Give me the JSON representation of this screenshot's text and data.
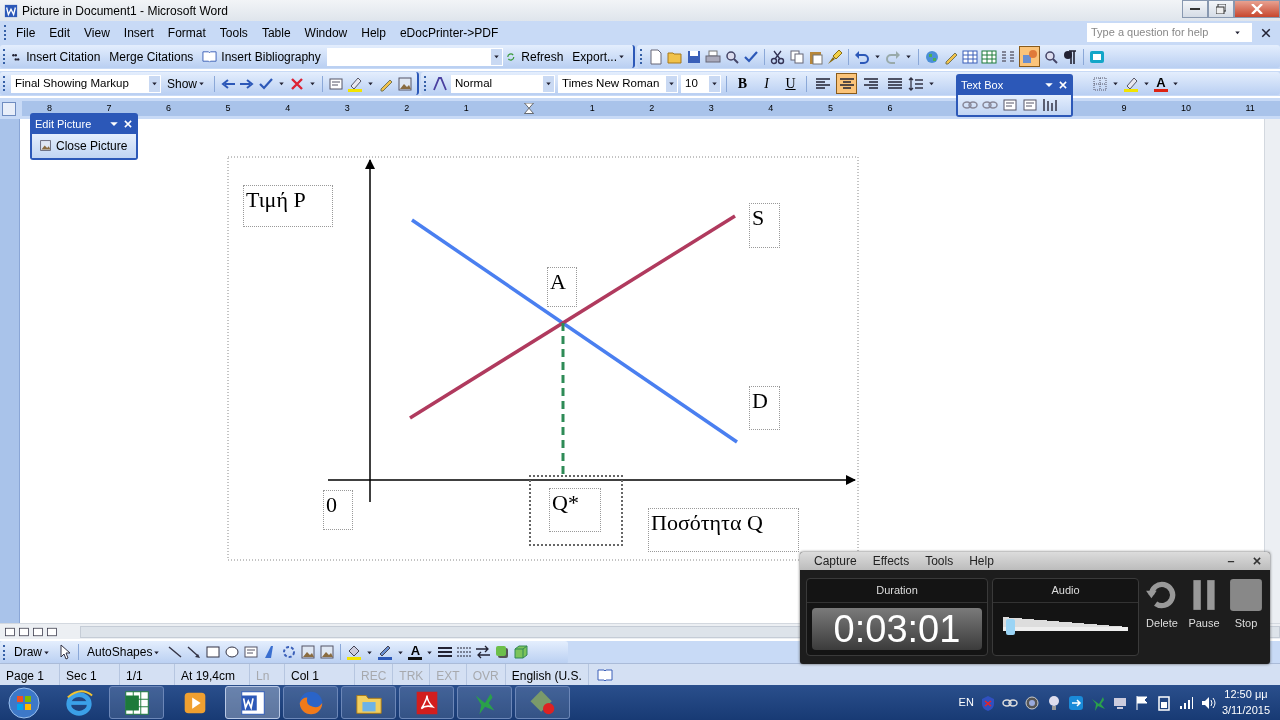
{
  "window": {
    "title": "Picture in Document1 - Microsoft Word"
  },
  "menu": [
    "File",
    "Edit",
    "View",
    "Insert",
    "Format",
    "Tools",
    "Table",
    "Window",
    "Help",
    "eDocPrinter->PDF"
  ],
  "help_box": {
    "placeholder": "Type a question for help"
  },
  "citation_toolbar": {
    "items": [
      "Insert Citation",
      "Merge Citations",
      "Insert Bibliography"
    ],
    "refresh": "Refresh",
    "export": "Export..."
  },
  "standard_toolbar": {
    "drawing_button_pressed": true
  },
  "reviewing_toolbar": {
    "display": "Final Showing Markup",
    "show": "Show"
  },
  "formatting_toolbar": {
    "style": "Normal",
    "font": "Times New Roman",
    "size": "10",
    "format_buttons": [
      {
        "label": "B",
        "selected": false
      },
      {
        "label": "I",
        "selected": false
      },
      {
        "label": "U",
        "selected": false
      }
    ],
    "alignments": [
      {
        "kind": "left",
        "selected": false
      },
      {
        "kind": "center",
        "selected": true
      },
      {
        "kind": "right",
        "selected": false
      },
      {
        "kind": "justify",
        "selected": false
      }
    ],
    "font_color_glyph": "A"
  },
  "ruler": {
    "left_numbers": [
      "8",
      "7",
      "6",
      "5",
      "4",
      "3",
      "2",
      "1"
    ],
    "right_numbers": [
      "1",
      "2",
      "3",
      "4",
      "5",
      "6"
    ],
    "numbers_past_toolbar": [
      "9",
      "10",
      "11"
    ]
  },
  "edit_picture_toolbar": {
    "title": "Edit Picture",
    "close_button": "Close Picture"
  },
  "text_box_toolbar": {
    "title": "Text Box"
  },
  "diagram": {
    "labels": [
      {
        "kind": "price_axis",
        "text": "Τιμή P",
        "selected": false
      },
      {
        "kind": "supply",
        "text": "S",
        "selected": false
      },
      {
        "kind": "equilibrium",
        "text": "A",
        "selected": false
      },
      {
        "kind": "demand",
        "text": "D",
        "selected": false
      },
      {
        "kind": "origin",
        "text": "0",
        "selected": false
      },
      {
        "kind": "equilibrium_quantity",
        "text": "Q*",
        "selected": true
      },
      {
        "kind": "quantity_axis",
        "text": "Ποσότητα Q",
        "selected": false
      }
    ]
  },
  "drawing_toolbar": {
    "draw": "Draw",
    "autoshapes": "AutoShapes",
    "font_color_glyph": "A"
  },
  "status_bar": [
    {
      "text": "Page 1",
      "disabled": false
    },
    {
      "text": "Sec 1",
      "disabled": false
    },
    {
      "text": "1/1",
      "disabled": false
    },
    {
      "text": "At 19,4cm",
      "disabled": false
    },
    {
      "text": "Ln",
      "disabled": true
    },
    {
      "text": "Col 1",
      "disabled": false
    },
    {
      "text": "REC",
      "disabled": true
    },
    {
      "text": "TRK",
      "disabled": true
    },
    {
      "text": "EXT",
      "disabled": true
    },
    {
      "text": "OVR",
      "disabled": true
    },
    {
      "text": "English (U.S.",
      "disabled": false
    }
  ],
  "recorder": {
    "menu": [
      "Capture",
      "Effects",
      "Tools",
      "Help"
    ],
    "duration_label": "Duration",
    "duration": "0:03:01",
    "audio_label": "Audio",
    "audio": {
      "level": 0.03
    },
    "buttons": [
      {
        "kind": "delete",
        "label": "Delete"
      },
      {
        "kind": "pause",
        "label": "Pause"
      },
      {
        "kind": "stop",
        "label": "Stop"
      }
    ]
  },
  "taskbar": {
    "apps": [
      {
        "kind": "ie",
        "running": false,
        "selected": false
      },
      {
        "kind": "excel",
        "running": true,
        "selected": false
      },
      {
        "kind": "media",
        "running": false,
        "selected": false
      },
      {
        "kind": "word",
        "running": true,
        "selected": true
      },
      {
        "kind": "firefox",
        "running": true,
        "selected": false
      },
      {
        "kind": "explorer",
        "running": true,
        "selected": false
      },
      {
        "kind": "pdf",
        "running": true,
        "selected": false
      },
      {
        "kind": "bird",
        "running": true,
        "selected": false
      },
      {
        "kind": "tool",
        "running": true,
        "selected": false
      }
    ],
    "language": "EN",
    "time": "12:50 μμ",
    "date": "3/11/2015"
  }
}
